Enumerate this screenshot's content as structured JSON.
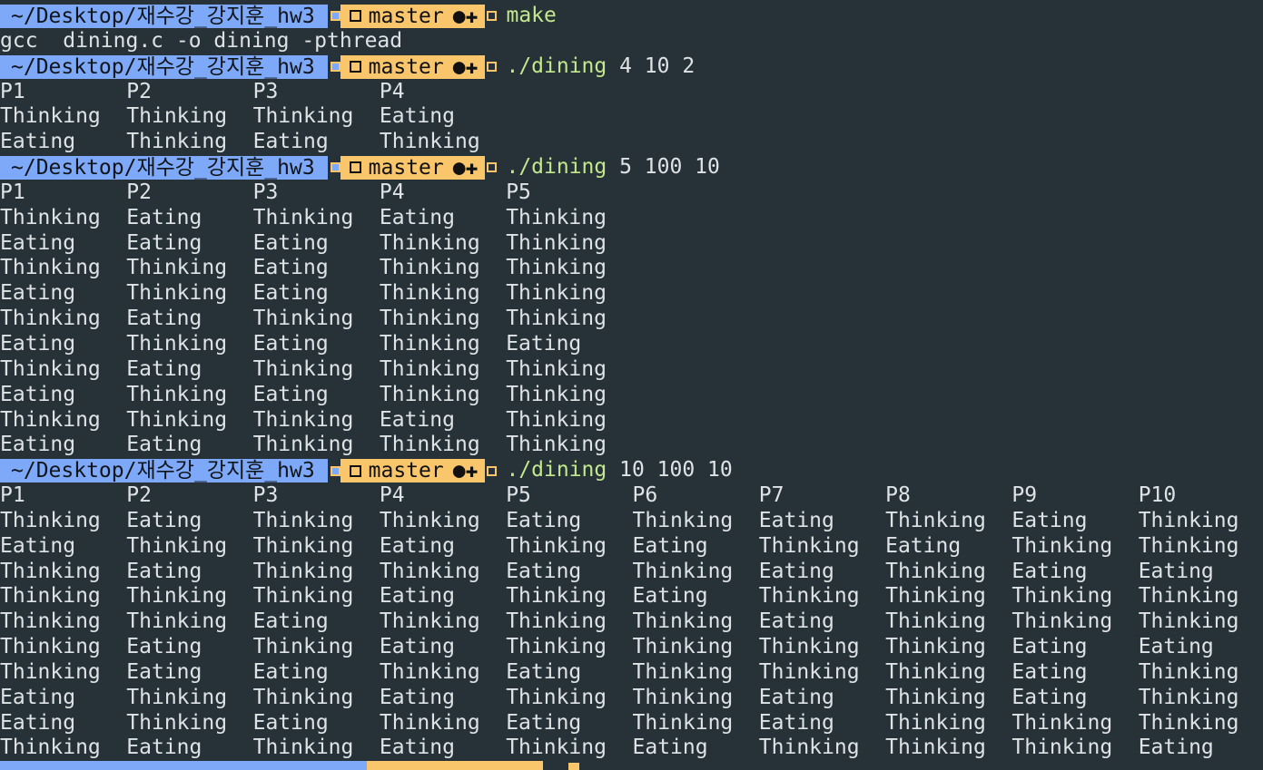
{
  "prompt": {
    "path": "~/Desktop/재수강_강지훈_hw3",
    "branch": "master",
    "status": "●✚"
  },
  "colors": {
    "background": "#263238",
    "path_segment": "#7ea8f8",
    "git_segment": "#f9c66b",
    "command": "#c3e88d",
    "text": "#dfe3e6"
  },
  "session": [
    {
      "command": "make",
      "args": "",
      "output": [
        "gcc  dining.c -o dining -pthread"
      ]
    },
    {
      "command": "./dining",
      "args": " 4 10 2",
      "table": [
        [
          "P1",
          "P2",
          "P3",
          "P4"
        ],
        [
          "Thinking",
          "Thinking",
          "Thinking",
          "Eating"
        ],
        [
          "Eating",
          "Thinking",
          "Eating",
          "Thinking"
        ]
      ]
    },
    {
      "command": "./dining",
      "args": " 5 100 10",
      "table": [
        [
          "P1",
          "P2",
          "P3",
          "P4",
          "P5"
        ],
        [
          "Thinking",
          "Eating",
          "Thinking",
          "Eating",
          "Thinking"
        ],
        [
          "Eating",
          "Eating",
          "Eating",
          "Thinking",
          "Thinking"
        ],
        [
          "Thinking",
          "Thinking",
          "Eating",
          "Thinking",
          "Thinking"
        ],
        [
          "Eating",
          "Thinking",
          "Eating",
          "Thinking",
          "Thinking"
        ],
        [
          "Thinking",
          "Eating",
          "Thinking",
          "Thinking",
          "Thinking"
        ],
        [
          "Eating",
          "Thinking",
          "Eating",
          "Thinking",
          "Eating"
        ],
        [
          "Thinking",
          "Eating",
          "Thinking",
          "Thinking",
          "Thinking"
        ],
        [
          "Eating",
          "Thinking",
          "Eating",
          "Thinking",
          "Thinking"
        ],
        [
          "Thinking",
          "Thinking",
          "Thinking",
          "Eating",
          "Thinking"
        ],
        [
          "Eating",
          "Eating",
          "Thinking",
          "Thinking",
          "Thinking"
        ]
      ]
    },
    {
      "command": "./dining",
      "args": " 10 100 10",
      "table": [
        [
          "P1",
          "P2",
          "P3",
          "P4",
          "P5",
          "P6",
          "P7",
          "P8",
          "P9",
          "P10"
        ],
        [
          "Thinking",
          "Eating",
          "Thinking",
          "Thinking",
          "Eating",
          "Thinking",
          "Eating",
          "Thinking",
          "Eating",
          "Thinking"
        ],
        [
          "Eating",
          "Thinking",
          "Thinking",
          "Eating",
          "Thinking",
          "Eating",
          "Thinking",
          "Eating",
          "Thinking",
          "Thinking"
        ],
        [
          "Thinking",
          "Eating",
          "Thinking",
          "Thinking",
          "Eating",
          "Thinking",
          "Eating",
          "Thinking",
          "Eating",
          "Eating"
        ],
        [
          "Thinking",
          "Thinking",
          "Thinking",
          "Eating",
          "Thinking",
          "Eating",
          "Thinking",
          "Thinking",
          "Thinking",
          "Thinking"
        ],
        [
          "Thinking",
          "Thinking",
          "Eating",
          "Thinking",
          "Thinking",
          "Thinking",
          "Eating",
          "Thinking",
          "Thinking",
          "Thinking"
        ],
        [
          "Thinking",
          "Eating",
          "Thinking",
          "Eating",
          "Thinking",
          "Thinking",
          "Thinking",
          "Thinking",
          "Eating",
          "Eating"
        ],
        [
          "Thinking",
          "Eating",
          "Eating",
          "Thinking",
          "Eating",
          "Thinking",
          "Thinking",
          "Thinking",
          "Eating",
          "Thinking"
        ],
        [
          "Eating",
          "Thinking",
          "Thinking",
          "Eating",
          "Thinking",
          "Thinking",
          "Eating",
          "Thinking",
          "Eating",
          "Thinking"
        ],
        [
          "Eating",
          "Thinking",
          "Eating",
          "Thinking",
          "Eating",
          "Thinking",
          "Eating",
          "Thinking",
          "Thinking",
          "Thinking"
        ],
        [
          "Thinking",
          "Eating",
          "Thinking",
          "Eating",
          "Thinking",
          "Eating",
          "Thinking",
          "Thinking",
          "Thinking",
          "Eating"
        ]
      ]
    }
  ]
}
